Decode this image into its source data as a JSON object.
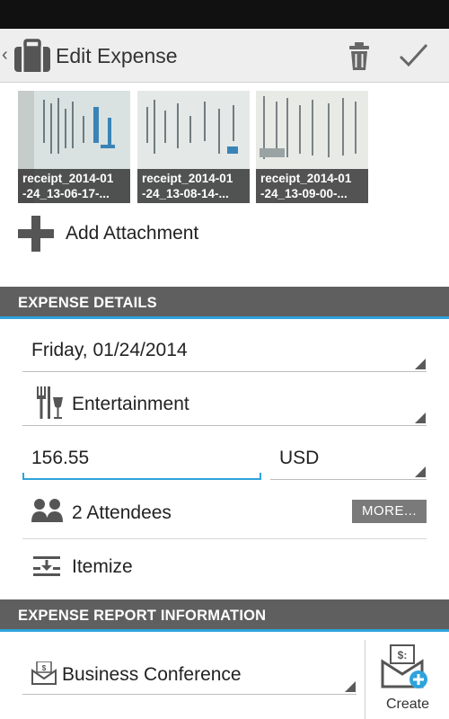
{
  "action_bar": {
    "title": "Edit Expense",
    "icons": {
      "up": "chevron-left-icon",
      "app": "briefcase-icon",
      "delete": "trash-icon",
      "save": "checkmark-icon"
    }
  },
  "attachments": {
    "items": [
      {
        "name": "receipt_2014-01\n-24_13-06-17-..."
      },
      {
        "name": "receipt_2014-01\n-24_13-08-14-..."
      },
      {
        "name": "receipt_2014-01\n-24_13-09-00-..."
      }
    ],
    "add_label": "Add Attachment"
  },
  "expense_details": {
    "header": "EXPENSE DETAILS",
    "date": "Friday, 01/24/2014",
    "type": "Entertainment",
    "amount": "156.55",
    "currency": "USD",
    "attendees": "2 Attendees",
    "more_label": "MORE...",
    "itemize": "Itemize"
  },
  "report_info": {
    "header": "EXPENSE REPORT INFORMATION",
    "report": "Business Conference",
    "create_label": "Create"
  },
  "colors": {
    "accent": "#2ea3dc",
    "header_bg": "#5f5f5f",
    "action_bar_bg": "#eeeeee"
  }
}
